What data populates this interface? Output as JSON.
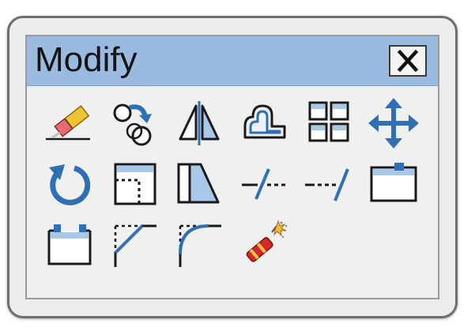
{
  "panel": {
    "title": "Modify",
    "close_icon": "close-icon"
  },
  "tools": [
    {
      "name": "erase",
      "icon": "eraser-icon"
    },
    {
      "name": "copy",
      "icon": "copy-icon"
    },
    {
      "name": "mirror",
      "icon": "mirror-icon"
    },
    {
      "name": "offset",
      "icon": "offset-icon"
    },
    {
      "name": "array",
      "icon": "array-icon"
    },
    {
      "name": "move",
      "icon": "move-icon"
    },
    {
      "name": "rotate",
      "icon": "rotate-icon"
    },
    {
      "name": "scale",
      "icon": "scale-icon"
    },
    {
      "name": "stretch",
      "icon": "stretch-icon"
    },
    {
      "name": "trim",
      "icon": "trim-icon"
    },
    {
      "name": "extend",
      "icon": "extend-icon"
    },
    {
      "name": "break-at-point",
      "icon": "break-at-point-icon"
    },
    {
      "name": "break",
      "icon": "break-icon"
    },
    {
      "name": "chamfer",
      "icon": "chamfer-icon"
    },
    {
      "name": "fillet",
      "icon": "fillet-icon"
    },
    {
      "name": "explode",
      "icon": "explode-icon"
    }
  ],
  "colors": {
    "titlebar": "#9bbae0",
    "panel": "#f0f0f0",
    "accent_blue": "#2e6fb5",
    "light_blue": "#a8c8ea",
    "icon_black": "#1a1a1a"
  }
}
